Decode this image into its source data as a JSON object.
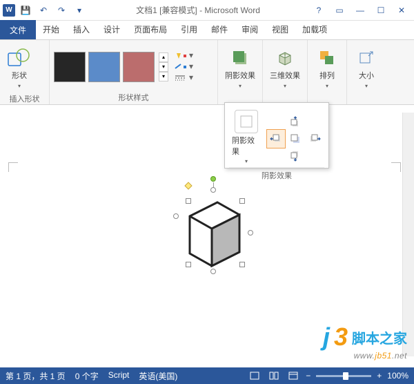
{
  "title": "文档1 [兼容模式] - Microsoft Word",
  "tabs": {
    "file": "文件",
    "home": "开始",
    "insert": "插入",
    "design": "设计",
    "layout": "页面布局",
    "ref": "引用",
    "mail": "邮件",
    "review": "审阅",
    "view": "视图",
    "addins": "加载项"
  },
  "ribbon": {
    "shapes_label": "形状",
    "insert_shapes_group": "插入形状",
    "shape_styles_group": "形状样式",
    "shadow_label": "阴影效果",
    "threeD_label": "三维效果",
    "arrange_label": "排列",
    "size_label": "大小"
  },
  "drop": {
    "shadow_label": "阴影效果",
    "footer": "阴影效果"
  },
  "status": {
    "page": "第 1 页，共 1 页",
    "words": "0 个字",
    "lang": "英语(美国)",
    "script": "Script",
    "zoom": "100%"
  },
  "watermark": {
    "cn": "脚本之家",
    "url_pre": "www.",
    "url_hl": "jb51",
    "url_post": ".net"
  },
  "glyphs": {
    "save": "💾",
    "undo": "↶",
    "redo": "↷",
    "help": "?",
    "restore": "▭",
    "min": "—",
    "max": "☐",
    "close": "✕",
    "dd": "▾",
    "up": "▴",
    "down": "▾",
    "more": "⤢",
    "collapse": "ˬ",
    "zminus": "−",
    "zplus": "+"
  }
}
